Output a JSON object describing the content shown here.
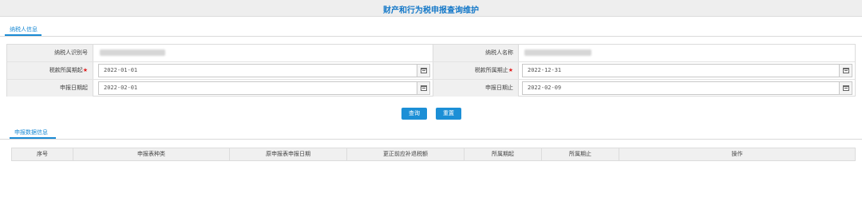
{
  "page": {
    "title": "财产和行为税申报查询维护"
  },
  "tabs": {
    "taxpayer_info": "纳税人信息",
    "declaration_data": "申报数据信息"
  },
  "form": {
    "taxpayer_id_label": "纳税人识别号",
    "taxpayer_name_label": "纳税人名称",
    "period_start_label": "税款所属期起",
    "period_end_label": "税款所属期止",
    "required_mark": "★",
    "declare_start_label": "申报日期起",
    "declare_end_label": "申报日期止",
    "period_start_value": "2022-01-01",
    "period_end_value": "2022-12-31",
    "declare_start_value": "2022-02-01",
    "declare_end_value": "2022-02-09"
  },
  "buttons": {
    "query": "查询",
    "reset": "重置"
  },
  "table": {
    "columns": [
      "序号",
      "申报表种类",
      "原申报表申报日期",
      "更正前应补退税额",
      "所属期起",
      "所属期止",
      "操作"
    ]
  }
}
